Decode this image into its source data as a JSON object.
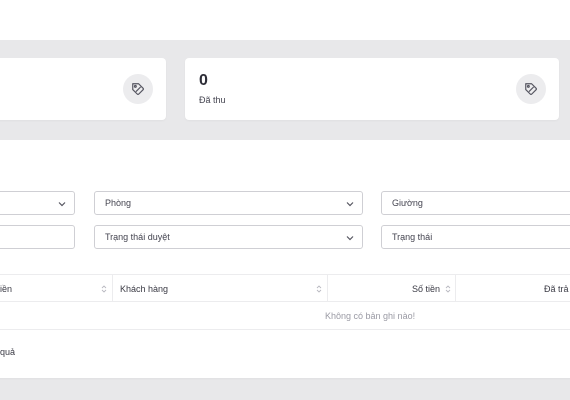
{
  "stats": [
    {
      "value": "",
      "label": "",
      "icon": "tag-icon"
    },
    {
      "value": "0",
      "label": "Đã thu",
      "icon": "tag-icon"
    }
  ],
  "filters": {
    "row1": [
      {
        "label": "",
        "has_dropdown": true
      },
      {
        "label": "Phòng",
        "has_dropdown": true
      },
      {
        "label": "Giường",
        "has_dropdown": false
      }
    ],
    "row2": [
      {
        "label": "",
        "has_dropdown": false
      },
      {
        "label": "Trạng thái duyệt",
        "has_dropdown": true
      },
      {
        "label": "Trạng thái",
        "has_dropdown": false
      }
    ]
  },
  "table": {
    "columns": [
      "iền",
      "Khách hàng",
      "Số tiền",
      "Đã trả"
    ],
    "empty_message": "Không có bản ghi nào!"
  },
  "footer": {
    "results_text": "quả"
  },
  "colors": {
    "band": "#e8e8ea",
    "card": "#ffffff",
    "border": "#cfcfd4",
    "muted_text": "#9a9aa4"
  }
}
